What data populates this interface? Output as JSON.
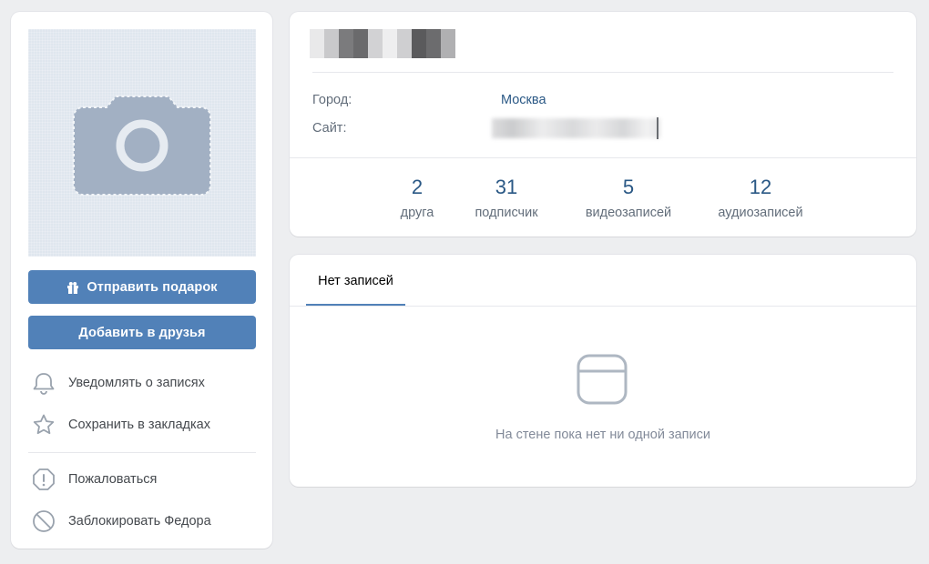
{
  "left": {
    "send_gift_label": "Отправить подарок",
    "add_friend_label": "Добавить в друзья",
    "actions": [
      {
        "label": "Уведомлять о записях",
        "icon": "bell-icon"
      },
      {
        "label": "Сохранить в закладках",
        "icon": "star-icon"
      },
      {
        "label": "Пожаловаться",
        "icon": "alert-icon"
      },
      {
        "label": "Заблокировать Федора",
        "icon": "block-icon"
      }
    ]
  },
  "profile": {
    "info": {
      "city_label": "Город:",
      "city_value": "Москва",
      "site_label": "Сайт:"
    },
    "counters": [
      {
        "value": "2",
        "label": "друга"
      },
      {
        "value": "31",
        "label": "подписчик"
      },
      {
        "value": "5",
        "label": "видеозаписей"
      },
      {
        "value": "12",
        "label": "аудиозаписей"
      }
    ]
  },
  "wall": {
    "tab_label": "Нет записей",
    "empty_text": "На стене пока нет ни одной записи"
  },
  "colors": {
    "accent": "#5181b8",
    "link": "#2a5885",
    "muted_text": "#626d7a",
    "background": "#edeef0"
  }
}
